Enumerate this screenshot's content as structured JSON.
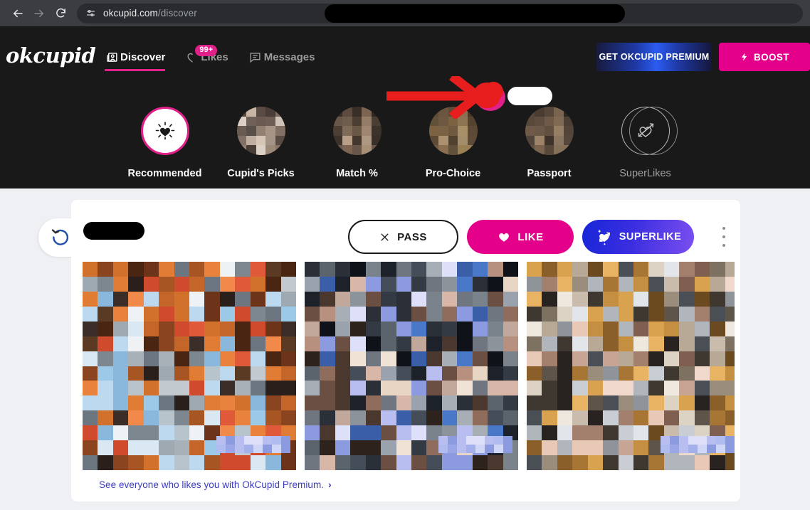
{
  "browser": {
    "back_icon": "back-arrow-icon",
    "forward_icon": "forward-arrow-icon",
    "reload_icon": "reload-icon",
    "site_settings_icon": "site-settings-icon",
    "url_host": "okcupid.com",
    "url_path": "/discover"
  },
  "header": {
    "logo": "okcupid",
    "tabs": [
      {
        "label": "Discover",
        "icon": "discover-icon",
        "active": true
      },
      {
        "label": "Likes",
        "icon": "likes-icon",
        "active": false,
        "badge": "99+"
      },
      {
        "label": "Messages",
        "icon": "messages-icon",
        "active": false
      }
    ],
    "premium_button": "GET OKCUPID PREMIUM",
    "boost_button": "BOOST",
    "boost_icon": "lightning-bolt-icon",
    "annotation_arrow": "red-arrow-annotation",
    "avatar_redaction": "redacted-avatar",
    "username_redaction": "redacted-username"
  },
  "categories": [
    {
      "label": "Recommended",
      "icon": "radiant-heart-icon",
      "type": "active-ring",
      "muted": false
    },
    {
      "label": "Cupid's Picks",
      "type": "photo",
      "muted": false,
      "palette": [
        "#5a4a44",
        "#6b5a52",
        "#8a7366",
        "#b39b8b",
        "#c9b5a4",
        "#7d6a5e",
        "#4a3c36",
        "#a89484",
        "#d6c6b6",
        "#938072",
        "#6d5d54",
        "#bfae9f",
        "#e3d8cc",
        "#827064",
        "#575048",
        "#9a8878",
        "#c0b0a2",
        "#b2a294",
        "#6f6158",
        "#3f3a35",
        "#cfc2b6",
        "#8e8076",
        "#a49486",
        "#dcd0c4",
        "#726358"
      ]
    },
    {
      "label": "Match %",
      "type": "photo",
      "muted": false,
      "palette": [
        "#3a2f28",
        "#4d3e33",
        "#6b5648",
        "#8a6f5d",
        "#5e4b3f",
        "#2e2620",
        "#7d6553",
        "#a08672",
        "#43372e",
        "#6a5746",
        "#937c68",
        "#b99f88",
        "#584638",
        "#3c322a",
        "#7f6b58",
        "#a89077",
        "#5a4a3c",
        "#32291f",
        "#6e5c4c",
        "#92795f",
        "#4a3e32",
        "#867260",
        "#ae9881",
        "#685748",
        "#3e342b"
      ]
    },
    {
      "label": "Pro-Choice",
      "type": "photo",
      "muted": false,
      "palette": [
        "#5e4a36",
        "#7d6242",
        "#9c7d53",
        "#b89a6c",
        "#6b5540",
        "#48382a",
        "#8a7050",
        "#a98f68",
        "#51412f",
        "#6f5a41",
        "#8d7453",
        "#ab9170",
        "#3f3226",
        "#5c4a36",
        "#7a6344",
        "#998055",
        "#4b3c2c",
        "#32281e",
        "#6d5941",
        "#8b7458",
        "#54432f",
        "#7f6a4c",
        "#a38d6a",
        "#62513a",
        "#3a2e22"
      ]
    },
    {
      "label": "Passport",
      "type": "photo",
      "muted": false,
      "palette": [
        "#57463a",
        "#6e5a47",
        "#876f58",
        "#a08a70",
        "#4a3c31",
        "#2f2721",
        "#7a6450",
        "#967e64",
        "#3e332b",
        "#614f40",
        "#806a54",
        "#9c8369",
        "#352b24",
        "#53443a",
        "#6b5847",
        "#85705a",
        "#443930",
        "#241d18",
        "#5f4e3f",
        "#7c6852",
        "#4d3f34",
        "#6f5c4a",
        "#8a7560",
        "#584839",
        "#332a22"
      ]
    },
    {
      "label": "SuperLikes",
      "icon": "heart-arrow-icon",
      "type": "outline",
      "muted": true
    }
  ],
  "card": {
    "undo_icon": "undo-rewind-icon",
    "name_redaction": "redacted-profile-name",
    "pass_button": "PASS",
    "pass_icon": "close-x-icon",
    "like_button": "LIKE",
    "like_icon": "heart-icon",
    "superlike_button": "SUPERLIKE",
    "superlike_icon": "superlike-heart-arrow-icon",
    "more_options_icon": "kebab-menu-icon",
    "photos": [
      {
        "name": "profile-photo-1",
        "palette": [
          "#d1712c",
          "#e07c33",
          "#c4652a",
          "#a85524",
          "#8a4420",
          "#6d3419",
          "#4a2612",
          "#f0894a",
          "#e8823c",
          "#3b2d28",
          "#2a1f1a",
          "#5b3a24",
          "#9cc9e8",
          "#bcd9ef",
          "#8ab8dd",
          "#d9e8f3",
          "#c2c9cf",
          "#a8b0b8",
          "#7d8790",
          "#e05a3a",
          "#d04a2e",
          "#b8c4cc",
          "#eef2f5",
          "#9ea9b2",
          "#6b7680"
        ]
      },
      {
        "name": "profile-photo-2",
        "palette": [
          "#2a2f38",
          "#1d222a",
          "#333a44",
          "#454d58",
          "#5b636d",
          "#7a828c",
          "#0f1218",
          "#8c939b",
          "#a8aeb5",
          "#c2a89a",
          "#d8b7a8",
          "#b8907f",
          "#8f6c5c",
          "#6b4f42",
          "#4a372d",
          "#2e231c",
          "#e8d5c4",
          "#f0e2d4",
          "#3a5fa8",
          "#4a78c8",
          "#8c9ae0",
          "#b8bff0",
          "#dde0f8",
          "#9aa3ad",
          "#6f7680"
        ]
      },
      {
        "name": "profile-photo-3",
        "palette": [
          "#d9a24f",
          "#e8b463",
          "#c58f42",
          "#a87634",
          "#8a5f29",
          "#6b4a1f",
          "#b8a896",
          "#c9bcac",
          "#ddd3c5",
          "#eee8de",
          "#9a8d7c",
          "#7d7162",
          "#5e5449",
          "#3f3831",
          "#282320",
          "#e8c9b8",
          "#f0d9cc",
          "#c8a494",
          "#a3806e",
          "#7e5f50",
          "#b0b6bc",
          "#c8ced4",
          "#e2e6ea",
          "#8e949a",
          "#4a4f55"
        ]
      }
    ],
    "photo_chip_palette": [
      "#b8bff0",
      "#8c9ae0",
      "#dde0f8",
      "#f0f2ff",
      "#a4b0ec",
      "#c6cdf4",
      "#e8eaff",
      "#9aa6e8",
      "#d0d6f8",
      "#b0bcf0"
    ],
    "premium_link": "See everyone who likes you with OkCupid Premium.",
    "premium_link_chevron": "›"
  },
  "colors": {
    "brand_pink": "#e5008c",
    "header_bg": "#191919",
    "page_bg": "#eef0f4",
    "premium_blue": "#2b5cf0",
    "link_indigo": "#3b3bbf",
    "annotation_red": "#e81d1d"
  }
}
